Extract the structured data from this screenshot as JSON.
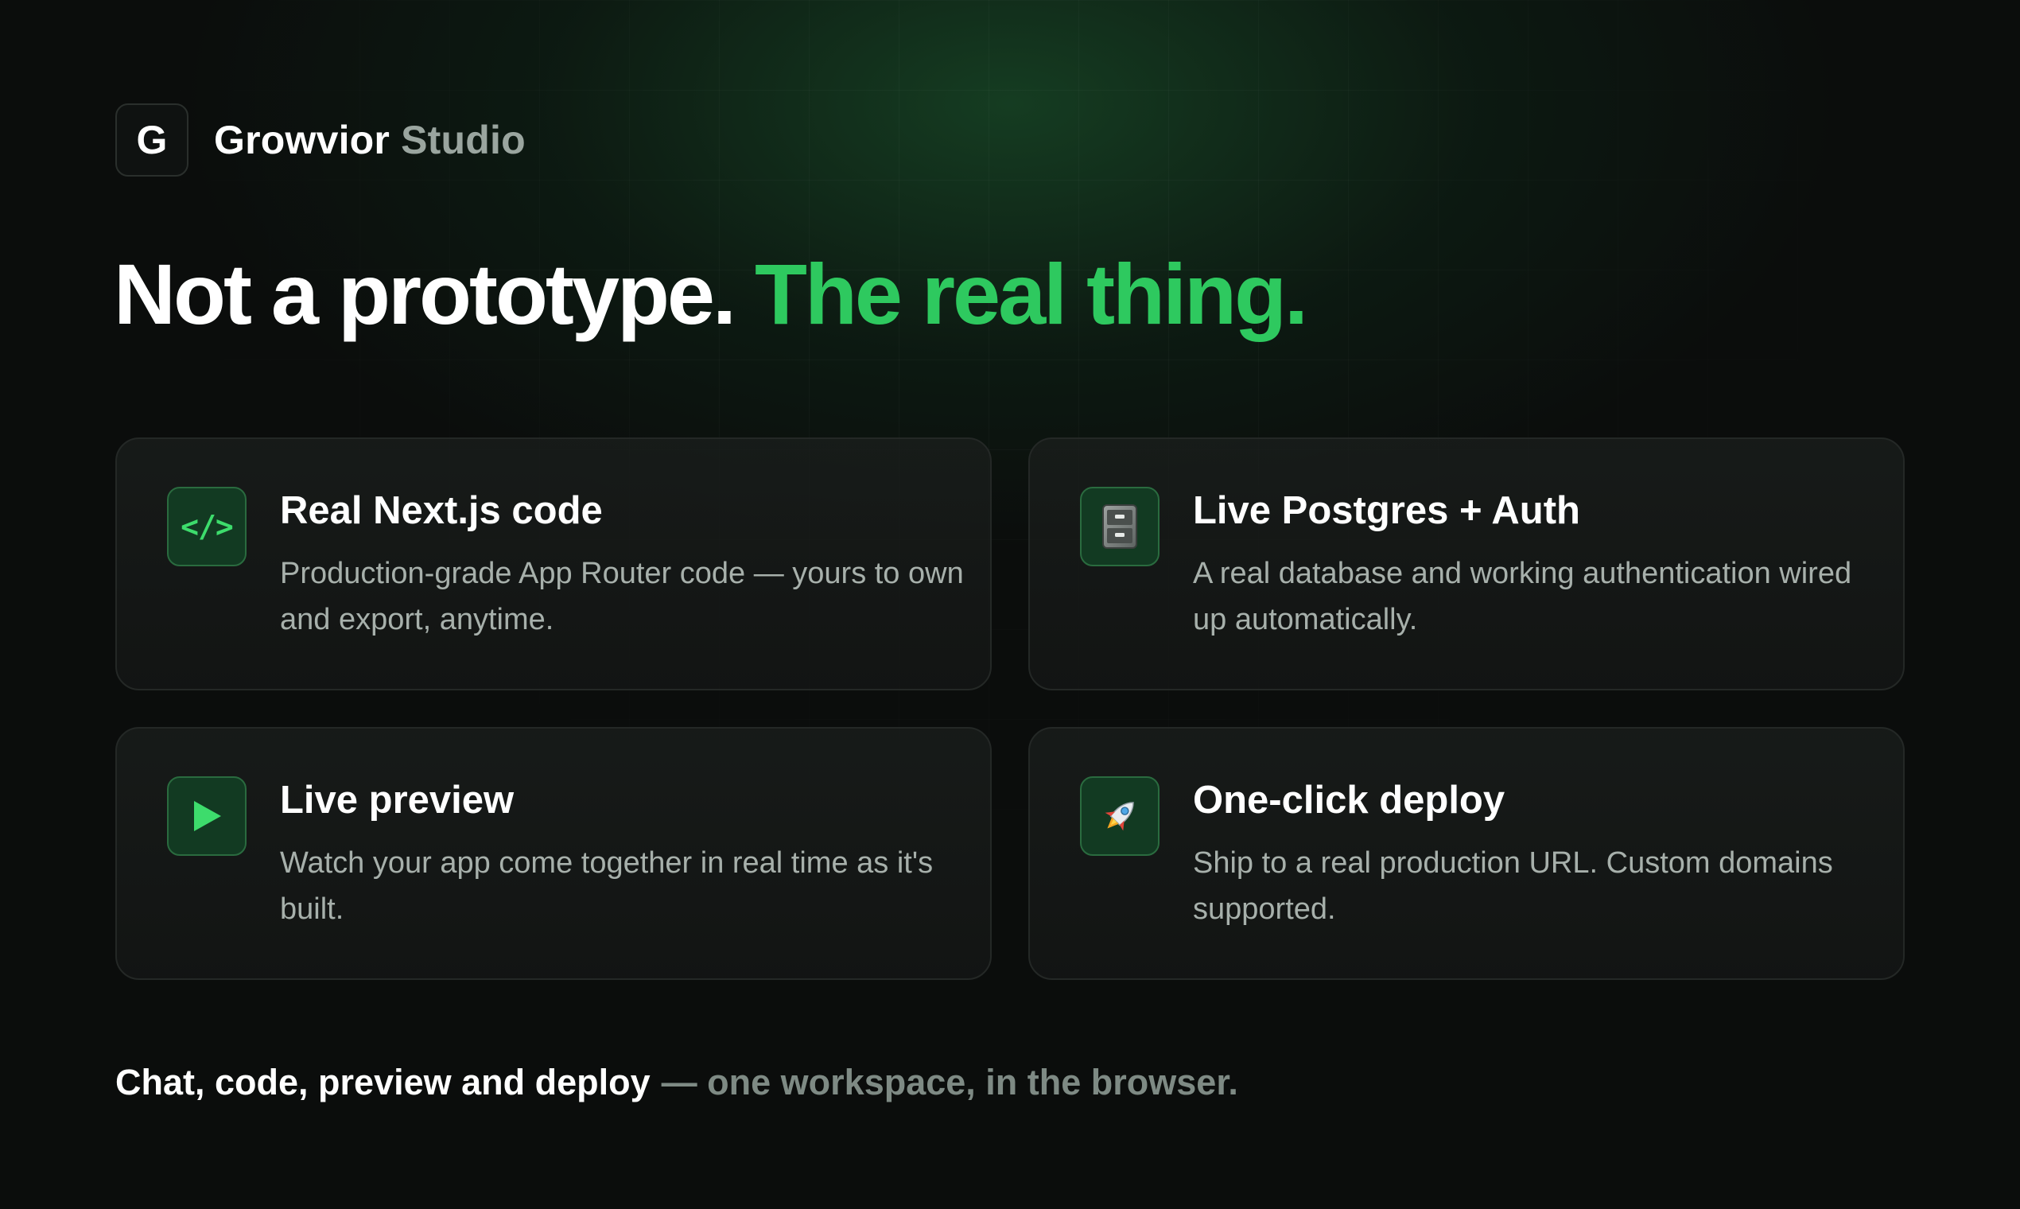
{
  "brand": {
    "logo_letter": "G",
    "name_primary": "Growvior",
    "name_secondary": "Studio"
  },
  "headline": {
    "part1": "Not a prototype.",
    "part2": "The real thing.",
    "accent_color": "#2ec95f"
  },
  "features": [
    {
      "icon": "code-icon",
      "icon_text": "</>",
      "title": "Real Next.js code",
      "description": "Production-grade App Router code — yours to own and export, anytime."
    },
    {
      "icon": "file-cabinet-icon",
      "title": "Live Postgres + Auth",
      "description": "A real database and working authentication wired up automatically."
    },
    {
      "icon": "play-icon",
      "title": "Live preview",
      "description": "Watch your app come together in real time as it's built."
    },
    {
      "icon": "rocket-icon",
      "title": "One-click deploy",
      "description": "Ship to a real production URL. Custom domains supported."
    }
  ],
  "footer": {
    "part1": "Chat, code, preview and deploy",
    "part2": "— one workspace, in the browser."
  }
}
